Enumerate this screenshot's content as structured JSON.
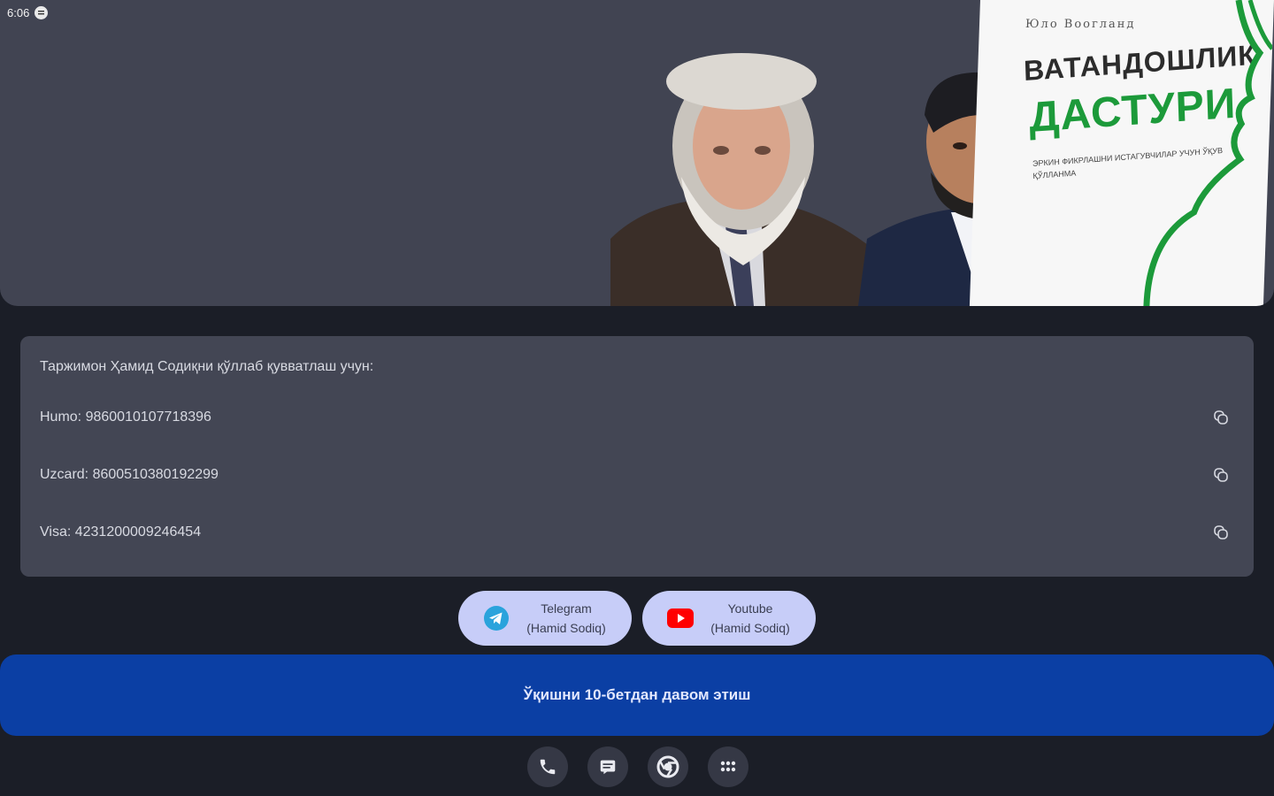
{
  "status_bar": {
    "time": "6:06"
  },
  "hero": {
    "book": {
      "author": "Юло Воогланд",
      "title_line1": "ВАТАНДОШЛИК",
      "title_line2": "ДАСТУРИ",
      "subtitle": "Эркин фикрлашни истагувчилар учун ўқув қўлланма"
    }
  },
  "support": {
    "title": "Таржимон Ҳамид Содиқни қўллаб қувватлаш учун:",
    "cards": [
      {
        "label": "Humo: 9860010107718396"
      },
      {
        "label": "Uzcard: 8600510380192299"
      },
      {
        "label": "Visa: 4231200009246454"
      }
    ]
  },
  "social": {
    "telegram": {
      "line1": "Telegram",
      "line2": "(Hamid Sodiq)"
    },
    "youtube": {
      "line1": "Youtube",
      "line2": "(Hamid Sodiq)"
    }
  },
  "continue_label": "Ўқишни 10-бетдан давом этиш",
  "dock": [
    "phone-icon",
    "messages-icon",
    "chrome-icon",
    "apps-grid-icon"
  ],
  "colors": {
    "accent": "#0b3fa4",
    "chip": "#c7cdf8",
    "card": "#434654",
    "background": "#1b1e27"
  }
}
